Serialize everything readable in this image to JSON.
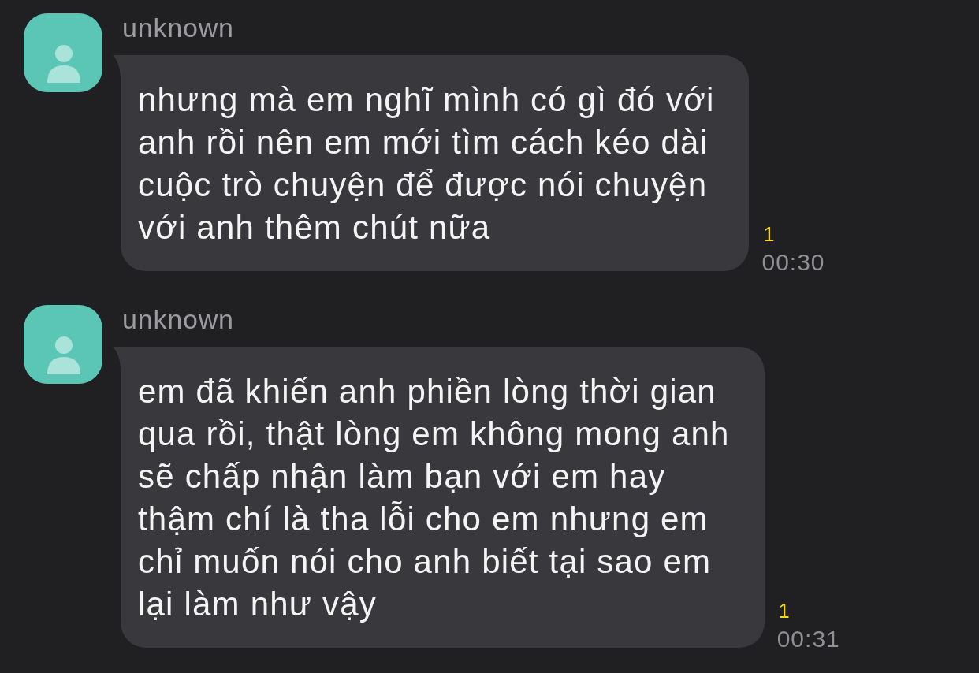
{
  "messages": [
    {
      "sender": "unknown",
      "text": "nhưng mà em nghĩ mình có gì đó với\nanh rồi nên em mới tìm cách kéo dài\ncuộc trò chuyện để được nói chuyện\nvới anh thêm chút nữa",
      "unread_count": "1",
      "time": "00:30"
    },
    {
      "sender": "unknown",
      "text": "em đã khiến anh phiền lòng thời gian\nqua rồi, thật lòng em không mong anh\nsẽ chấp nhận làm bạn với em hay\nthậm chí là tha lỗi cho em nhưng em\nchỉ muốn nói cho anh biết tại sao em\nlại làm như vậy",
      "unread_count": "1",
      "time": "00:31"
    }
  ]
}
